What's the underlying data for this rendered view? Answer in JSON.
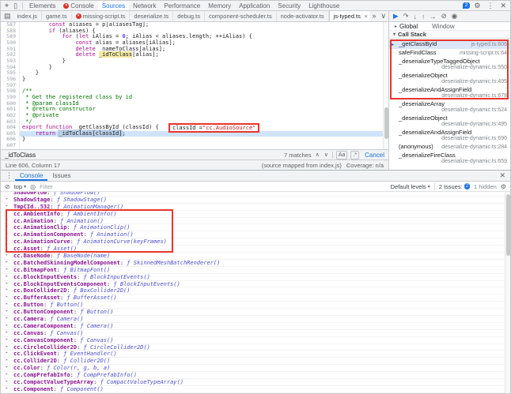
{
  "colors": {
    "accent": "#1a73e8",
    "annotation": "#e7362e",
    "error": "#d93025",
    "badge_blue": "#1a73e8",
    "exec_line": "#cfe3fa"
  },
  "devtools": {
    "left_icons": [
      {
        "name": "inspect-icon",
        "glyph": "⌖"
      },
      {
        "name": "device-toolbar-icon",
        "glyph": "▯"
      }
    ],
    "tabs": [
      {
        "label": "Elements"
      },
      {
        "label": "Console",
        "error_badge": true
      },
      {
        "label": "Sources",
        "active": true
      },
      {
        "label": "Network"
      },
      {
        "label": "Performance"
      },
      {
        "label": "Memory"
      },
      {
        "label": "Application"
      },
      {
        "label": "Security"
      },
      {
        "label": "Lighthouse"
      }
    ],
    "issues_badge": "2",
    "right_icons": [
      {
        "name": "settings-gear-icon",
        "glyph": "⚙"
      },
      {
        "name": "kebab-menu-icon",
        "glyph": "⋮"
      },
      {
        "name": "close-devtools-icon",
        "glyph": "✕"
      }
    ]
  },
  "sources": {
    "navigator_toggle_glyph": "▤",
    "overflow_glyph": "»",
    "chevron_glyph": "∨",
    "file_tabs": [
      {
        "label": "index.js"
      },
      {
        "label": "game.ts"
      },
      {
        "label": "missing-script.ts",
        "error_badge": true
      },
      {
        "label": "deserialize.ts"
      },
      {
        "label": "debug.ts"
      },
      {
        "label": "component-scheduler.ts"
      },
      {
        "label": "node-activator.ts"
      },
      {
        "label": "js-typed.ts",
        "active": true,
        "close_glyph": "✕"
      }
    ],
    "code": {
      "lines": [
        {
          "n": 587,
          "t": [
            [
              "pl",
              "        "
            ],
            [
              "kw",
              "const"
            ],
            [
              "pl",
              " aliases = p[aliasesTag];"
            ]
          ]
        },
        {
          "n": 588,
          "t": [
            [
              "pl",
              "        "
            ],
            [
              "kw",
              "if"
            ],
            [
              "pl",
              " (aliases) {"
            ]
          ]
        },
        {
          "n": 589,
          "t": [
            [
              "pl",
              "            "
            ],
            [
              "kw",
              "for"
            ],
            [
              "pl",
              " ("
            ],
            [
              "kw",
              "let"
            ],
            [
              "pl",
              " iAlias = "
            ],
            [
              "num",
              "0"
            ],
            [
              "pl",
              "; iAlias < aliases.length; ++iAlias) {"
            ]
          ]
        },
        {
          "n": 590,
          "t": [
            [
              "pl",
              "                "
            ],
            [
              "kw",
              "const"
            ],
            [
              "pl",
              " alias = aliases[iAlias];"
            ]
          ]
        },
        {
          "n": 591,
          "t": [
            [
              "pl",
              "                "
            ],
            [
              "kw",
              "delete"
            ],
            [
              "pl",
              " _nameToClass[alias];"
            ]
          ]
        },
        {
          "n": 592,
          "t": [
            [
              "pl",
              "                "
            ],
            [
              "kw",
              "delete"
            ],
            [
              "pl",
              " "
            ],
            [
              "m",
              "_idToClass"
            ],
            [
              "pl",
              "[alias];"
            ]
          ]
        },
        {
          "n": 593,
          "t": [
            [
              "pl",
              "            }"
            ]
          ]
        },
        {
          "n": 594,
          "t": [
            [
              "pl",
              "        }"
            ]
          ]
        },
        {
          "n": 595,
          "t": [
            [
              "pl",
              "    }"
            ]
          ]
        },
        {
          "n": 596,
          "t": [
            [
              "pl",
              "}"
            ]
          ]
        },
        {
          "n": 597,
          "t": []
        },
        {
          "n": 598,
          "t": [
            [
              "cmt",
              "/**"
            ]
          ]
        },
        {
          "n": 599,
          "t": [
            [
              "cmt",
              " * Get the registered class by id"
            ]
          ]
        },
        {
          "n": 600,
          "t": [
            [
              "cmt",
              " * @param classId"
            ]
          ]
        },
        {
          "n": 601,
          "t": [
            [
              "cmt",
              " * @return constructor"
            ]
          ]
        },
        {
          "n": 602,
          "t": [
            [
              "cmt",
              " * @private"
            ]
          ]
        },
        {
          "n": 603,
          "t": [
            [
              "cmt",
              " */"
            ]
          ]
        },
        {
          "n": 604,
          "t": [
            [
              "kw",
              "export"
            ],
            [
              "pl",
              " "
            ],
            [
              "kw",
              "function"
            ],
            [
              "pl",
              " _getClassById (classId) {"
            ]
          ]
        },
        {
          "n": 605,
          "exec": true,
          "t": [
            [
              "pl",
              "    "
            ],
            [
              "kw",
              "return"
            ],
            [
              "pl",
              " "
            ],
            [
              "mc",
              "_idToClass[classId]"
            ],
            [
              "pl",
              ";"
            ]
          ]
        },
        {
          "n": 606,
          "t": [
            [
              "pl",
              "}"
            ]
          ]
        },
        {
          "n": 607,
          "t": []
        }
      ]
    },
    "inline_annotation": {
      "label": "classId = ",
      "value": "\"cc.AudioSource\""
    },
    "find_bar": {
      "query": "_idToClass",
      "matches": "7 matches",
      "prev": "∧",
      "next": "∨",
      "case_sensitive": "Aa",
      "regex": ".*",
      "cancel": "Cancel"
    },
    "status_bar": {
      "position": "Line 606, Column 17",
      "source_map": "(source mapped from index.js)",
      "coverage": "Coverage: n/a"
    }
  },
  "debugger": {
    "toolbar": [
      {
        "name": "resume-icon",
        "glyph": "▶",
        "accent": true
      },
      {
        "name": "step-over-icon",
        "glyph": "↷"
      },
      {
        "name": "step-into-icon",
        "glyph": "↓"
      },
      {
        "name": "step-out-icon",
        "glyph": "↑"
      },
      {
        "name": "step-icon",
        "glyph": "→"
      },
      {
        "name": "deactivate-breakpoints-icon",
        "glyph": "⊘"
      },
      {
        "name": "pause-on-exceptions-icon",
        "glyph": "◉"
      }
    ],
    "scope": {
      "expander": "▸",
      "label": "Global",
      "value": "Window"
    },
    "call_stack": {
      "expander": "▾",
      "header": "Call Stack",
      "frames": [
        {
          "name": "_getClassById",
          "loc": "js-typed.ts:606",
          "current": true
        },
        {
          "name": "safeFindClass",
          "loc": "missing-script.ts:64"
        },
        {
          "name": "_deserializeTypeTaggedObject",
          "loc": "deserialize-dynamic.ts:550"
        },
        {
          "name": "_deserializeObject",
          "loc": "deserialize-dynamic.ts:495"
        },
        {
          "name": "_deserializeAndAssignField",
          "loc": "deserialize-dynamic.ts:678"
        },
        {
          "name": "_deserializeArray",
          "loc": "deserialize-dynamic.ts:524"
        },
        {
          "name": "_deserializeObject",
          "loc": "deserialize-dynamic.ts:495"
        },
        {
          "name": "_deserializeAndAssignField",
          "loc": "deserialize-dynamic.ts:690"
        },
        {
          "name": "(anonymous)",
          "loc": "deserialize-dynamic.ts:284"
        },
        {
          "name": "_deserializeFireClass",
          "loc": "deserialize-dynamic.ts:659"
        }
      ]
    }
  },
  "console": {
    "kebab_glyph": "⋮",
    "close_glyph": "✕",
    "drawer_tabs": [
      {
        "label": "Console",
        "active": true
      },
      {
        "label": "Issues"
      }
    ],
    "toolbar": {
      "clear_glyph": "⊘",
      "context": "top",
      "chevron": "▾",
      "eye_glyph": "◎",
      "filter_placeholder": "Filter",
      "levels": "Default levels",
      "issues_label": "2 Issues:",
      "issues_badge": "2",
      "hidden_label": "1 hidden",
      "settings_glyph": "⚙"
    },
    "entries": [
      {
        "key": "ShadowFlow",
        "fn": "ShadowFlow()"
      },
      {
        "key": "ShadowStage",
        "fn": "ShadowStage()"
      },
      {
        "key": "TmpCId..532",
        "fn": "AnimationManager()"
      },
      {
        "key": "cc.AmbientInfo",
        "fn": "AmbientInfo()"
      },
      {
        "key": "cc.Animation",
        "fn": "Animation()"
      },
      {
        "key": "cc.AnimationClip",
        "fn": "AnimationClip()"
      },
      {
        "key": "cc.AnimationComponent",
        "fn": "Animation()"
      },
      {
        "key": "cc.AnimationCurve",
        "fn": "AnimationCurve(keyFrames)"
      },
      {
        "key": "cc.Asset",
        "fn": "Asset()"
      },
      {
        "key": "cc.BaseNode",
        "fn": "BaseNode(name)"
      },
      {
        "key": "cc.BatchedSkinningModelComponent",
        "fn": "SkinnedMeshBatchRenderer()"
      },
      {
        "key": "cc.BitmapFont",
        "fn": "BitmapFont()"
      },
      {
        "key": "cc.BlockInputEvents",
        "fn": "BlockInputEvents()"
      },
      {
        "key": "cc.BlockInputEventsComponent",
        "fn": "BlockInputEvents()"
      },
      {
        "key": "cc.BoxCollider2D",
        "fn": "BoxCollider2D()"
      },
      {
        "key": "cc.BufferAsset",
        "fn": "BufferAsset()"
      },
      {
        "key": "cc.Button",
        "fn": "Button()"
      },
      {
        "key": "cc.ButtonComponent",
        "fn": "Button()"
      },
      {
        "key": "cc.Camera",
        "fn": "Camera()"
      },
      {
        "key": "cc.CameraComponent",
        "fn": "Camera()"
      },
      {
        "key": "cc.Canvas",
        "fn": "Canvas()"
      },
      {
        "key": "cc.CanvasComponent",
        "fn": "Canvas()"
      },
      {
        "key": "cc.CircleCollider2D",
        "fn": "CircleCollider2D()"
      },
      {
        "key": "cc.ClickEvent",
        "fn": "EventHandler()"
      },
      {
        "key": "cc.Collider2D",
        "fn": "Collider2D()"
      },
      {
        "key": "cc.Color",
        "fn": "Color(r, g, b, a)"
      },
      {
        "key": "cc.CompPrefabInfo",
        "fn": "CompPrefabInfo()"
      },
      {
        "key": "cc.CompactValueTypeArray",
        "fn": "CompactValueTypeArray()"
      },
      {
        "key": "cc.Component",
        "fn": "Component()"
      }
    ]
  }
}
